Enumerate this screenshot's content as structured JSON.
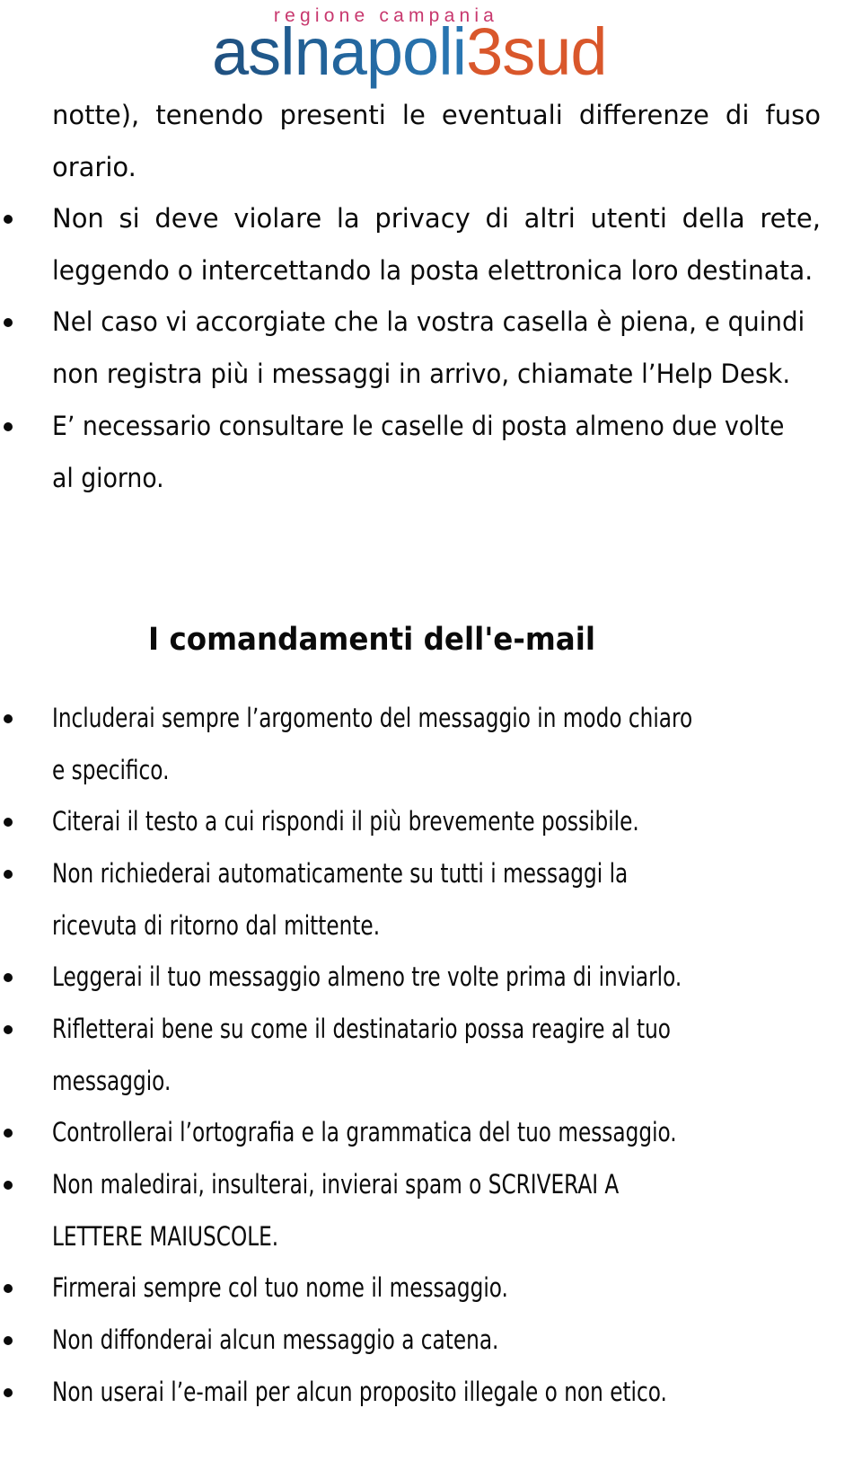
{
  "header": {
    "logo_subtitle": "regione campania",
    "logo_main_blue": "aslnapoli",
    "logo_main_orange": "3sud",
    "colors": {
      "subtitle": "#c8386e",
      "blue": "#23679f",
      "orange": "#d9572b"
    }
  },
  "section1": {
    "continuation": {
      "lines": [
        "notte), tenendo presenti le eventuali differenze di fuso",
        "orario."
      ]
    },
    "items": [
      {
        "lines": [
          "Non si deve violare la privacy di altri utenti della rete,",
          "leggendo o intercettando la posta elettronica loro destinata."
        ]
      },
      {
        "lines": [
          "Nel caso vi accorgiate che la vostra casella è piena, e quindi",
          "non registra più i messaggi in arrivo, chiamate l’Help Desk."
        ]
      },
      {
        "lines": [
          "E’ necessario consultare le caselle di posta almeno due volte",
          "al giorno."
        ]
      }
    ]
  },
  "section2": {
    "title": "I comandamenti dell'e-mail",
    "items": [
      {
        "lines": [
          "Includerai sempre l’argomento del messaggio in modo chiaro",
          "e specifico."
        ]
      },
      {
        "lines": [
          "Citerai il testo a cui rispondi il più brevemente possibile."
        ]
      },
      {
        "lines": [
          "Non richiederai automaticamente su tutti i messaggi la",
          "ricevuta di ritorno dal mittente."
        ]
      },
      {
        "lines": [
          "Leggerai il tuo messaggio almeno tre volte prima di inviarlo."
        ]
      },
      {
        "lines": [
          "Rifletterai bene su come il destinatario possa reagire al tuo",
          "messaggio."
        ]
      },
      {
        "lines": [
          "Controllerai l’ortografia e la grammatica del tuo messaggio."
        ]
      },
      {
        "lines": [
          "Non maledirai, insulterai, invierai spam o SCRIVERAI A",
          "LETTERE MAIUSCOLE."
        ]
      },
      {
        "lines": [
          "Firmerai sempre col tuo nome il messaggio."
        ]
      },
      {
        "lines": [
          "Non diffonderai alcun messaggio a catena."
        ]
      },
      {
        "lines": [
          "Non userai l’e-mail per alcun proposito illegale o non etico."
        ]
      }
    ]
  }
}
